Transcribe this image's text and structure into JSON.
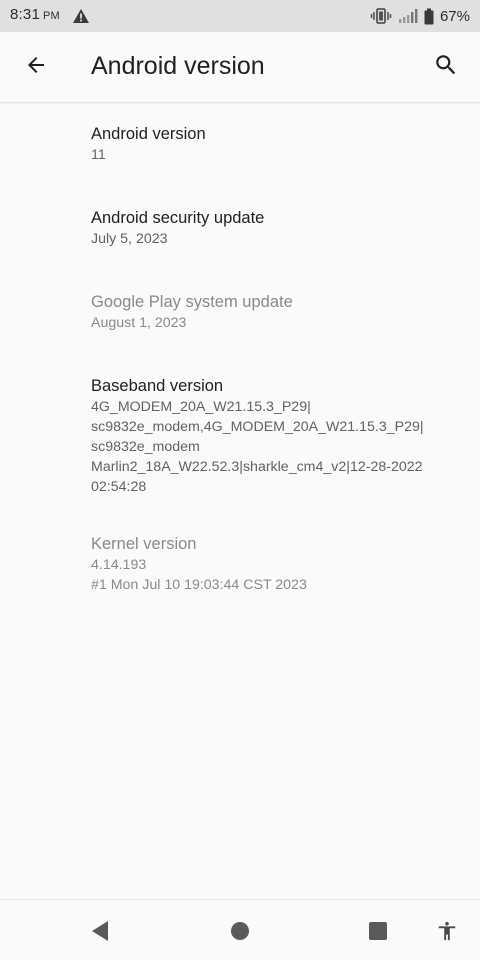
{
  "status_bar": {
    "time": "8:31",
    "ampm": "PM",
    "battery_percent": "67%",
    "icons": [
      "warning-icon",
      "vibrate-icon",
      "signal-icon",
      "battery-icon"
    ]
  },
  "app_bar": {
    "title": "Android version",
    "icons": [
      "arrow-back-icon",
      "search-icon"
    ]
  },
  "items": [
    {
      "title": "Android version",
      "summary": "11",
      "enabled": true
    },
    {
      "title": "Android security update",
      "summary": "July 5, 2023",
      "enabled": true
    },
    {
      "title": "Google Play system update",
      "summary": "August 1, 2023",
      "enabled": false
    },
    {
      "title": "Baseband version",
      "summary": "4G_MODEM_20A_W21.15.3_P29|\nsc9832e_modem,4G_MODEM_20A_W21.15.3_P29|\nsc9832e_modem\nMarlin2_18A_W22.52.3|sharkle_cm4_v2|12-28-2022\n02:54:28",
      "enabled": true
    },
    {
      "title": "Kernel version",
      "summary": "4.14.193\n#1 Mon Jul 10 19:03:44 CST 2023",
      "enabled": false
    }
  ],
  "nav_bar": {
    "icons": [
      "back-triangle-icon",
      "home-circle-icon",
      "recents-square-icon",
      "accessibility-icon"
    ]
  },
  "colors": {
    "status_bar_bg": "#e0e0e0",
    "background": "#fafafa",
    "primary_text": "#202124",
    "secondary_text": "#5f6368",
    "disabled_text": "#8a8a8a",
    "nav_icon": "#5a5a5a"
  }
}
